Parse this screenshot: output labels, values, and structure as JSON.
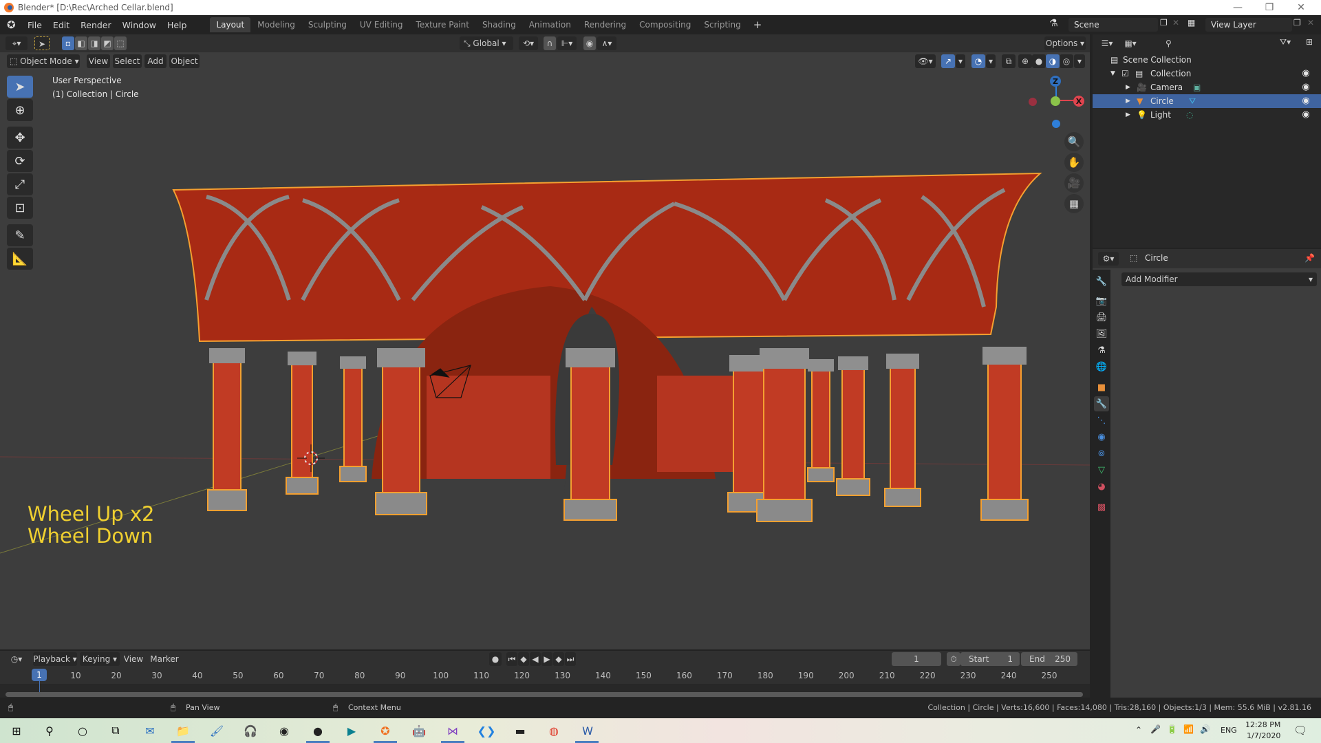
{
  "window": {
    "title": "Blender* [D:\\Rec\\Arched Cellar.blend]",
    "controls": {
      "minimize": "—",
      "restore": "❐",
      "close": "✕"
    }
  },
  "menubar": {
    "menus": [
      "File",
      "Edit",
      "Render",
      "Window",
      "Help"
    ],
    "workspaces": [
      "Layout",
      "Modeling",
      "Sculpting",
      "UV Editing",
      "Texture Paint",
      "Shading",
      "Animation",
      "Rendering",
      "Compositing",
      "Scripting"
    ],
    "active_workspace": "Layout",
    "add_workspace": "+",
    "scene": "Scene",
    "view_layer": "View Layer"
  },
  "viewport_header": {
    "mode": "Object Mode",
    "menus": [
      "View",
      "Select",
      "Add",
      "Object"
    ],
    "transform_orientation": "Global",
    "options": "Options"
  },
  "viewport": {
    "view_name": "User Perspective",
    "context": "(1) Collection | Circle",
    "key_overlay": [
      "Wheel Up x2",
      "Wheel Down"
    ],
    "gizmo_axes": {
      "z": "Z",
      "x": "X"
    },
    "tools": [
      "select-box",
      "cursor",
      "move",
      "rotate",
      "scale",
      "transform",
      "annotate",
      "measure"
    ],
    "nav_buttons": [
      "zoom",
      "pan",
      "camera",
      "ortho-grid"
    ]
  },
  "outliner": {
    "search_placeholder": "",
    "root": "Scene Collection",
    "collection": "Collection",
    "items": [
      {
        "name": "Camera",
        "type": "camera",
        "selected": false
      },
      {
        "name": "Circle",
        "type": "mesh",
        "selected": true
      },
      {
        "name": "Light",
        "type": "light",
        "selected": false
      }
    ]
  },
  "properties": {
    "object_name": "Circle",
    "add_modifier": "Add Modifier",
    "tabs": [
      "tool",
      "render",
      "output",
      "view-layer",
      "scene",
      "world",
      "object",
      "modifiers",
      "particles",
      "physics",
      "constraints",
      "data",
      "material",
      "texture"
    ],
    "active_tab": "modifiers"
  },
  "timeline": {
    "menus": [
      "Playback",
      "Keying",
      "View",
      "Marker"
    ],
    "current_frame": "1",
    "start_label": "Start",
    "start": "1",
    "end_label": "End",
    "end": "250",
    "ticks": [
      "10",
      "20",
      "30",
      "40",
      "50",
      "60",
      "70",
      "80",
      "90",
      "100",
      "110",
      "120",
      "130",
      "140",
      "150",
      "160",
      "170",
      "180",
      "190",
      "200",
      "210",
      "220",
      "230",
      "240",
      "250"
    ],
    "playhead_label": "1"
  },
  "statusbar": {
    "left_hint": "",
    "middle_hint": "Pan View",
    "right_hint": "Context Menu",
    "stats": "Collection | Circle | Verts:16,600 | Faces:14,080 | Tris:28,160 | Objects:1/3 | Mem: 55.6 MiB | v2.81.16"
  },
  "taskbar": {
    "apps": [
      "start",
      "search",
      "cortana",
      "task-view",
      "thunderbird",
      "file-explorer",
      "paint",
      "audacity",
      "media-player",
      "obs",
      "filmora",
      "blender",
      "godot",
      "visual-studio",
      "vscode",
      "terminal",
      "chrome",
      "word"
    ],
    "tray": {
      "language": "ENG",
      "time": "12:28 PM",
      "date": "1/7/2020"
    }
  },
  "colors": {
    "accent": "#4772b3",
    "selection_outline": "#f5a030",
    "overlay_text": "#f0d030",
    "x_axis": "#e0444e",
    "y_axis": "#8bc34a",
    "z_axis": "#2f7fd9"
  }
}
